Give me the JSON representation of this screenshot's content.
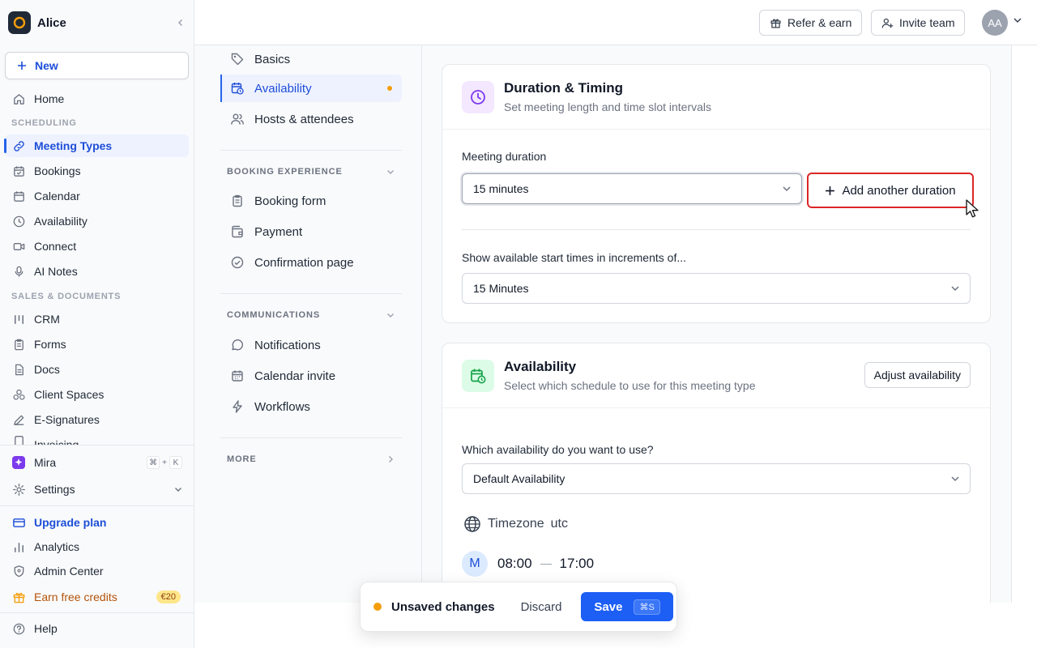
{
  "sidebar": {
    "workspace": "Alice",
    "new_label": "New",
    "home": "Home",
    "sections": {
      "scheduling": "SCHEDULING",
      "sales": "SALES & DOCUMENTS"
    },
    "scheduling_items": [
      {
        "label": "Meeting Types",
        "icon": "link-icon"
      },
      {
        "label": "Bookings",
        "icon": "calendar-check-icon"
      },
      {
        "label": "Calendar",
        "icon": "calendar-icon"
      },
      {
        "label": "Availability",
        "icon": "clock-icon"
      },
      {
        "label": "Connect",
        "icon": "video-icon"
      },
      {
        "label": "AI Notes",
        "icon": "microphone-icon"
      }
    ],
    "sales_items": [
      {
        "label": "CRM",
        "icon": "columns-icon"
      },
      {
        "label": "Forms",
        "icon": "clipboard-icon"
      },
      {
        "label": "Docs",
        "icon": "document-icon"
      },
      {
        "label": "Client Spaces",
        "icon": "cubes-icon"
      },
      {
        "label": "E-Signatures",
        "icon": "pen-icon"
      },
      {
        "label": "Invoicing",
        "icon": "invoice-icon"
      }
    ],
    "mira": "Mira",
    "mira_keys": [
      "⌘",
      "+",
      "K"
    ],
    "settings": "Settings",
    "upgrade": "Upgrade plan",
    "analytics": "Analytics",
    "admin": "Admin Center",
    "earn": "Earn free credits",
    "earn_badge": "€20",
    "help": "Help"
  },
  "topbar": {
    "refer": "Refer & earn",
    "invite": "Invite team",
    "avatar": "AA"
  },
  "subnav": {
    "items_top": [
      "Basics",
      "Availability",
      "Hosts & attendees"
    ],
    "booking_title": "BOOKING EXPERIENCE",
    "booking_items": [
      "Booking form",
      "Payment",
      "Confirmation page"
    ],
    "comm_title": "COMMUNICATIONS",
    "comm_items": [
      "Notifications",
      "Calendar invite",
      "Workflows"
    ],
    "more": "MORE"
  },
  "duration_card": {
    "title": "Duration & Timing",
    "subtitle": "Set meeting length and time slot intervals",
    "duration_label": "Meeting duration",
    "duration_value": "15 minutes",
    "add_button": "Add another duration",
    "increment_label": "Show available start times in increments of...",
    "increment_value": "15 Minutes"
  },
  "availability_card": {
    "title": "Availability",
    "subtitle": "Select which schedule to use for this meeting type",
    "adjust_button": "Adjust availability",
    "which_label": "Which availability do you want to use?",
    "which_value": "Default Availability",
    "timezone_label": "Timezone",
    "timezone_value": "utc",
    "day": "M",
    "start": "08:00",
    "end": "17:00"
  },
  "toast": {
    "message": "Unsaved changes",
    "discard": "Discard",
    "save": "Save",
    "save_shortcut": "⌘S"
  },
  "colors": {
    "accent": "#1d4ed8",
    "danger": "#dc2626",
    "warning": "#f59e0b"
  }
}
